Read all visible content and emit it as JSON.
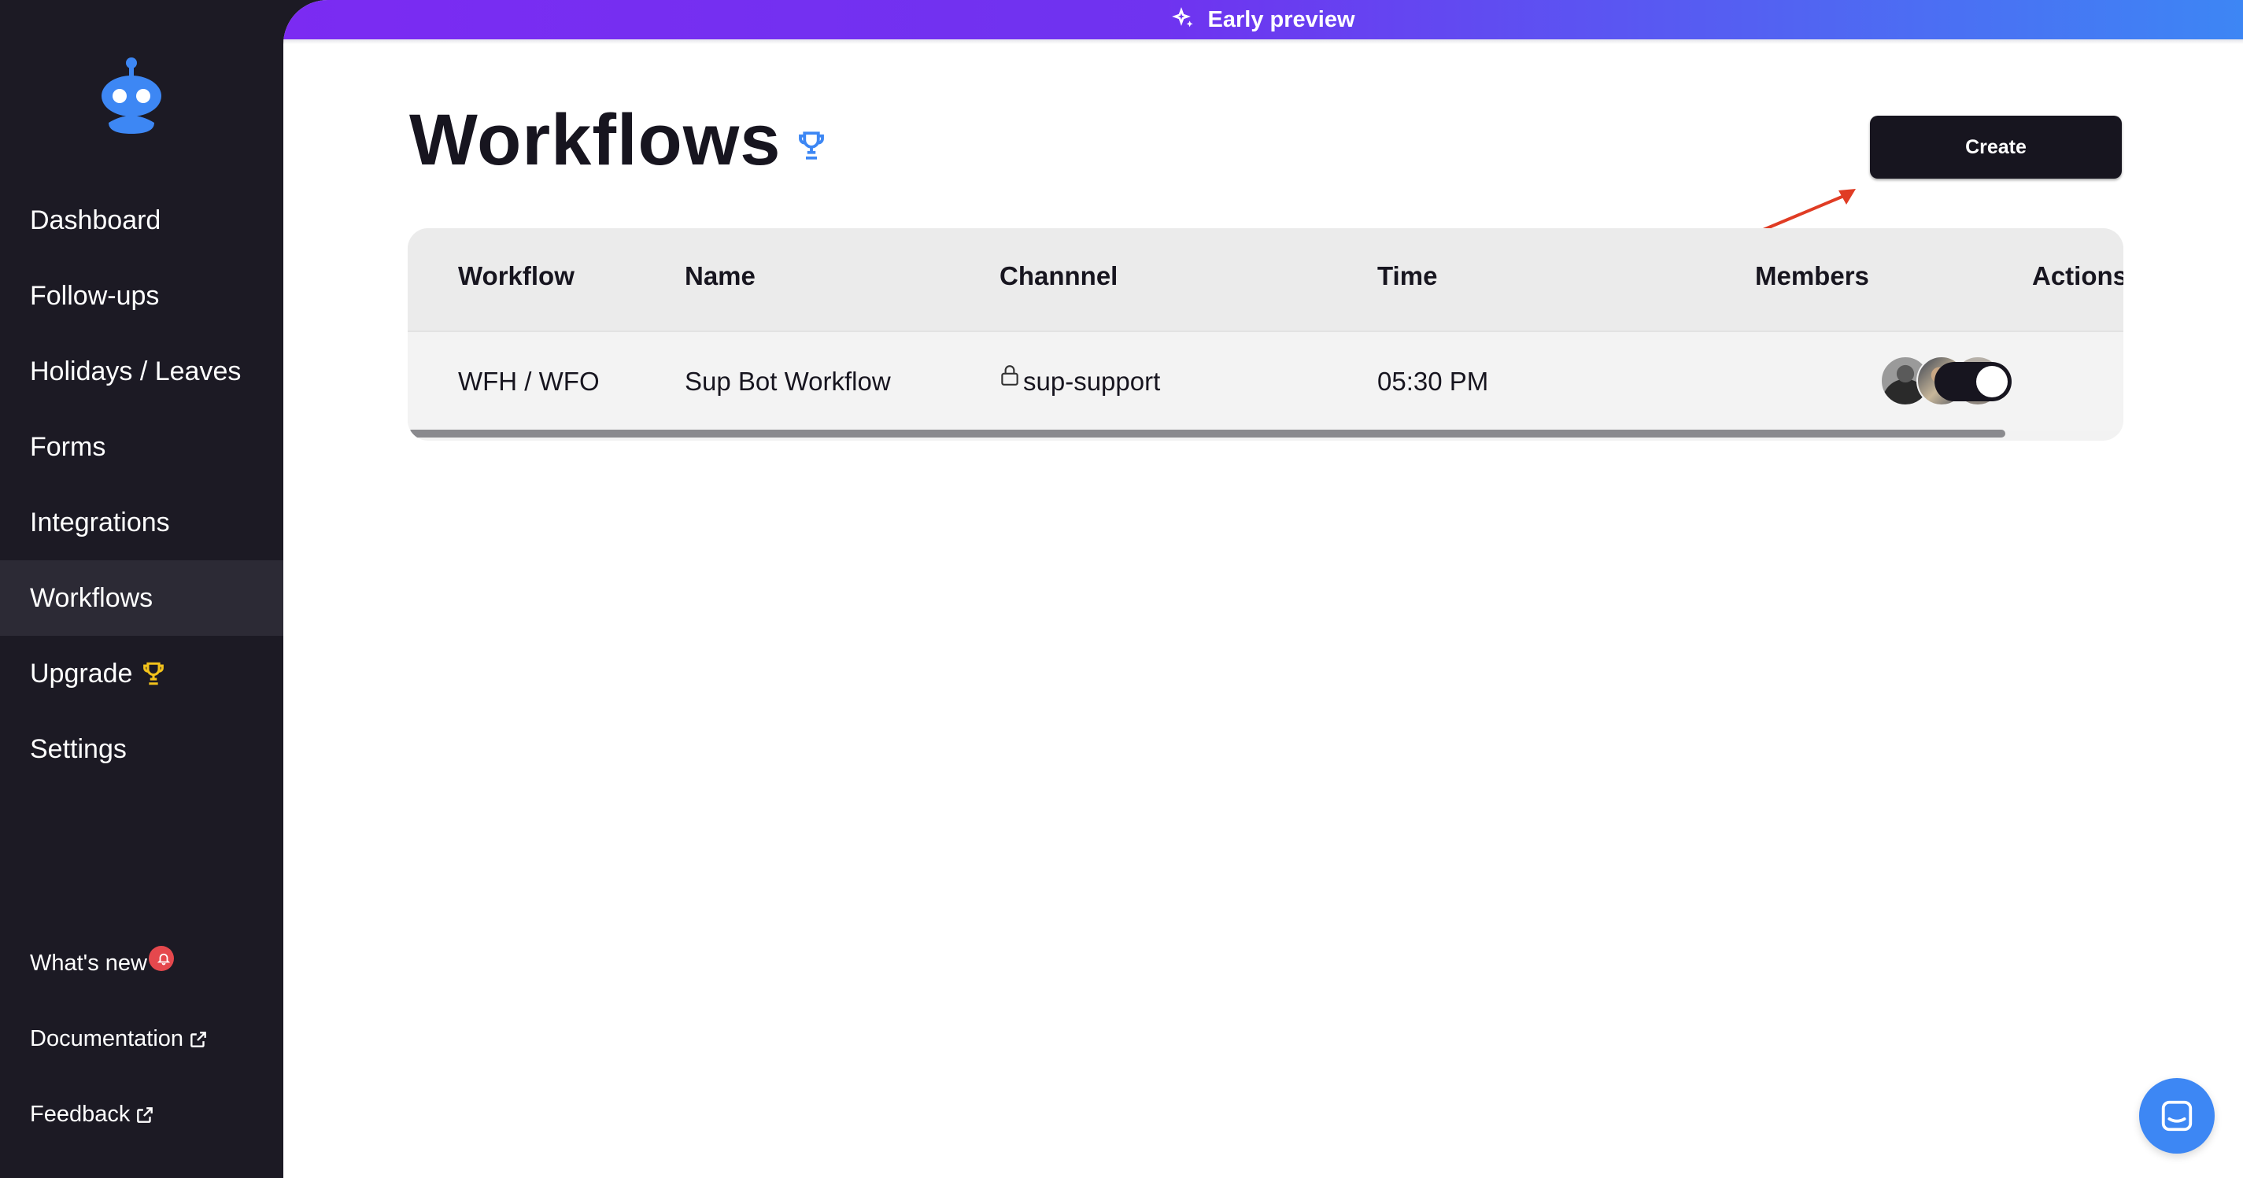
{
  "banner": {
    "label": "Early preview",
    "gradient_start": "#7b2bf2",
    "gradient_end": "#3d86f4"
  },
  "sidebar": {
    "logo": "robot-logo",
    "items": [
      {
        "label": "Dashboard"
      },
      {
        "label": "Follow-ups"
      },
      {
        "label": "Holidays / Leaves"
      },
      {
        "label": "Forms"
      },
      {
        "label": "Integrations"
      },
      {
        "label": "Workflows",
        "active": true
      },
      {
        "label": "Upgrade",
        "icon": "trophy-icon"
      },
      {
        "label": "Settings"
      }
    ],
    "footer": [
      {
        "label": "What's new",
        "icon": "bell-icon"
      },
      {
        "label": "Documentation",
        "icon": "external-link-icon"
      },
      {
        "label": "Feedback",
        "icon": "external-link-icon"
      }
    ]
  },
  "page": {
    "title": "Workflows",
    "title_icon": "trophy-icon",
    "create_label": "Create"
  },
  "table": {
    "headers": [
      "Workflow",
      "Name",
      "Channnel",
      "Time",
      "Members",
      "Actions"
    ],
    "rows": [
      {
        "workflow": "WFH / WFO",
        "name": "Sup Bot Workflow",
        "channel": "sup-support",
        "channel_icon": "lock-icon",
        "time": "05:30 PM",
        "members": [
          "member-avatar",
          "member-avatar",
          "member-avatar"
        ],
        "enabled": true
      }
    ]
  },
  "colors": {
    "accent_blue": "#3d87f4",
    "dark": "#17151f",
    "sidebar_bg": "#1c1a24",
    "trophy_gold": "#f2c21b",
    "annotation_arrow": "#e03c24"
  }
}
